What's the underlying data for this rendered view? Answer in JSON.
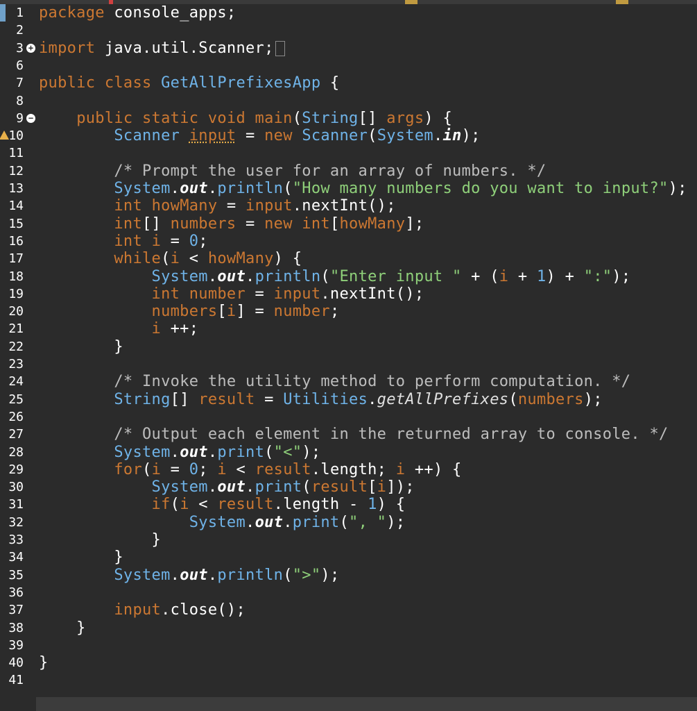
{
  "editor": {
    "lines": [
      {
        "n": "1",
        "html": "<span class='kw'>package</span> console_apps;"
      },
      {
        "n": "2",
        "html": ""
      },
      {
        "n": "3",
        "html": "<span class='kw'>import</span> java.util.Scanner;<span class='box'></span>",
        "fold": "+"
      },
      {
        "n": "6",
        "html": ""
      },
      {
        "n": "7",
        "html": "<span class='kw'>public class</span> <span class='typ'>GetAllPrefixesApp</span> {"
      },
      {
        "n": "8",
        "html": ""
      },
      {
        "n": "9",
        "html": "    <span class='kw'>public static void</span> <span class='kw'>main</span>(<span class='typ'>String</span>[] <span class='kw'>args</span>) {",
        "fold": "-"
      },
      {
        "n": "10",
        "html": "        <span class='typ'>Scanner</span> <span class='warnline kw'>input</span> = <span class='kw'>new</span> <span class='typ'>Scanner</span>(<span class='typ'>System</span>.<span class='fld'>in</span>);",
        "warn": true
      },
      {
        "n": "11",
        "html": ""
      },
      {
        "n": "12",
        "html": "        <span class='cm'>/* Prompt the user for an array of numbers. */</span>"
      },
      {
        "n": "13",
        "html": "        <span class='typ'>System</span>.<span class='fld'>out</span>.<span class='typ'>println</span>(<span class='str'>\"How many numbers do you want to input?\"</span>);"
      },
      {
        "n": "14",
        "html": "        <span class='kw'>int</span> <span class='kw'>howMany</span> = <span class='kw'>input</span>.nextInt();"
      },
      {
        "n": "15",
        "html": "        <span class='kw'>int</span>[] <span class='kw'>numbers</span> = <span class='kw'>new int</span>[<span class='kw'>howMany</span>];"
      },
      {
        "n": "16",
        "html": "        <span class='kw'>int</span> <span class='kw'>i</span> = <span class='typ'>0</span>;"
      },
      {
        "n": "17",
        "html": "        <span class='kw'>while</span>(<span class='kw'>i</span> &lt; <span class='kw'>howMany</span>) {"
      },
      {
        "n": "18",
        "html": "            <span class='typ'>System</span>.<span class='fld'>out</span>.<span class='typ'>println</span>(<span class='str'>\"Enter input \"</span> + (<span class='kw'>i</span> + <span class='typ'>1</span>) + <span class='str'>\":\"</span>);"
      },
      {
        "n": "19",
        "html": "            <span class='kw'>int</span> <span class='kw'>number</span> = <span class='kw'>input</span>.nextInt();"
      },
      {
        "n": "20",
        "html": "            <span class='kw'>numbers</span>[<span class='kw'>i</span>] = <span class='kw'>number</span>;"
      },
      {
        "n": "21",
        "html": "            <span class='kw'>i</span> ++;"
      },
      {
        "n": "22",
        "html": "        }"
      },
      {
        "n": "23",
        "html": ""
      },
      {
        "n": "24",
        "html": "        <span class='cm'>/* Invoke the utility method to perform computation. */</span>"
      },
      {
        "n": "25",
        "html": "        <span class='typ'>String</span>[] <span class='kw'>result</span> = <span class='typ'>Utilities</span>.<span class='sm'>getAllPrefixes</span>(<span class='kw'>numbers</span>);"
      },
      {
        "n": "26",
        "html": ""
      },
      {
        "n": "27",
        "html": "        <span class='cm'>/* Output each element in the returned array to console. */</span>"
      },
      {
        "n": "28",
        "html": "        <span class='typ'>System</span>.<span class='fld'>out</span>.<span class='typ'>print</span>(<span class='str'>\"&lt;\"</span>);"
      },
      {
        "n": "29",
        "html": "        <span class='kw'>for</span>(<span class='kw'>i</span> = <span class='typ'>0</span>; <span class='kw'>i</span> &lt; <span class='kw'>result</span>.length; <span class='kw'>i</span> ++) {"
      },
      {
        "n": "30",
        "html": "            <span class='typ'>System</span>.<span class='fld'>out</span>.<span class='typ'>print</span>(<span class='kw'>result</span>[<span class='kw'>i</span>]);"
      },
      {
        "n": "31",
        "html": "            <span class='kw'>if</span>(<span class='kw'>i</span> &lt; <span class='kw'>result</span>.length - <span class='typ'>1</span>) {"
      },
      {
        "n": "32",
        "html": "                <span class='typ'>System</span>.<span class='fld'>out</span>.<span class='typ'>print</span>(<span class='str'>\", \"</span>);"
      },
      {
        "n": "33",
        "html": "            }"
      },
      {
        "n": "34",
        "html": "        }"
      },
      {
        "n": "35",
        "html": "        <span class='typ'>System</span>.<span class='fld'>out</span>.<span class='typ'>println</span>(<span class='str'>\"&gt;\"</span>);"
      },
      {
        "n": "36",
        "html": ""
      },
      {
        "n": "37",
        "html": "        <span class='kw'>input</span>.close();"
      },
      {
        "n": "38",
        "html": "    }"
      },
      {
        "n": "39",
        "html": ""
      },
      {
        "n": "40",
        "html": "}"
      },
      {
        "n": "41",
        "html": ""
      }
    ]
  },
  "colors": {
    "background": "#2b2b2b",
    "keyword": "#cc7832",
    "string": "#8fd07a",
    "type": "#6fb3e8",
    "warning": "#e8b04a"
  }
}
